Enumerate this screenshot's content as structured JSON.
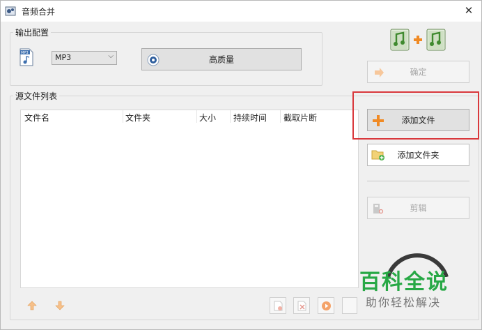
{
  "window": {
    "title": "音频合并",
    "close_glyph": "✕"
  },
  "output_config": {
    "group_title": "输出配置",
    "format_value": "MP3",
    "quality_label": "高质量"
  },
  "right_panel": {
    "confirm_label": "确定",
    "add_file_label": "添加文件",
    "add_folder_label": "添加文件夹",
    "cut_label": "剪辑"
  },
  "source_list": {
    "group_title": "源文件列表",
    "columns": [
      "文件名",
      "文件夹",
      "大小",
      "持续时间",
      "截取片断"
    ]
  },
  "watermark": {
    "title": "百科全说",
    "subtitle": "助你轻松解决"
  },
  "colors": {
    "highlight": "#d9383c",
    "watermark_green": "#27a845",
    "accent_orange": "#f08a24"
  },
  "icons": [
    "app-icon",
    "mp3-file-icon",
    "quality-gear-icon",
    "merge-audio-icon",
    "confirm-arrow-icon",
    "plus-icon",
    "folder-add-icon",
    "cut-icon",
    "move-up-icon",
    "move-down-icon",
    "remove-icon",
    "clear-icon",
    "play-icon"
  ]
}
